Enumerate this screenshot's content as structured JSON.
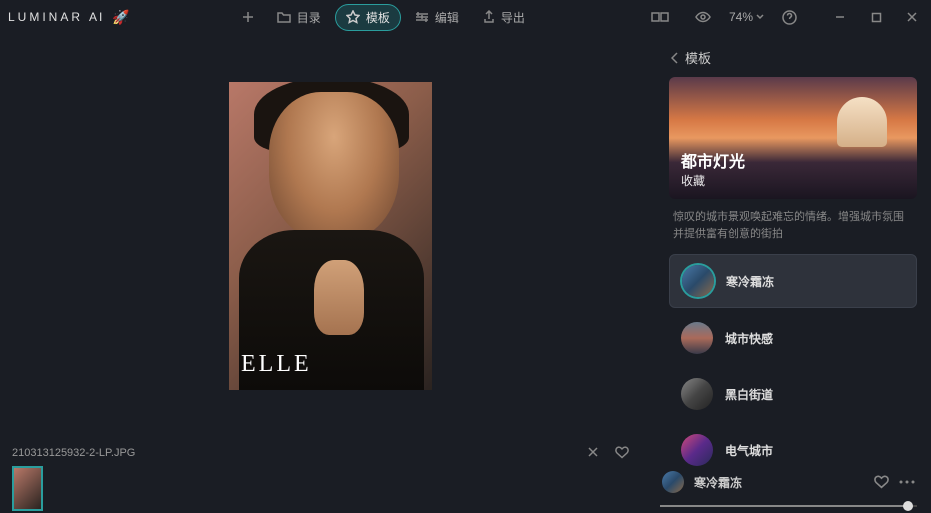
{
  "app": {
    "name": "LUMINAR",
    "suffix": "AI"
  },
  "toolbar": {
    "catalog": "目录",
    "templates": "模板",
    "edit": "编辑",
    "export": "导出"
  },
  "zoom": "74%",
  "file": {
    "name": "210313125932-2-LP.JPG",
    "watermark": "ELLE"
  },
  "panel": {
    "back": "模板",
    "hero": {
      "title": "都市灯光",
      "subtitle": "收藏"
    },
    "desc": "惊叹的城市景观唤起难忘的情绪。增强城市氛围并提供富有创意的街拍",
    "templates": [
      {
        "label": "寒冷霜冻"
      },
      {
        "label": "城市快感"
      },
      {
        "label": "黑白街道"
      },
      {
        "label": "电气城市"
      }
    ]
  },
  "applied": {
    "label": "寒冷霜冻"
  }
}
